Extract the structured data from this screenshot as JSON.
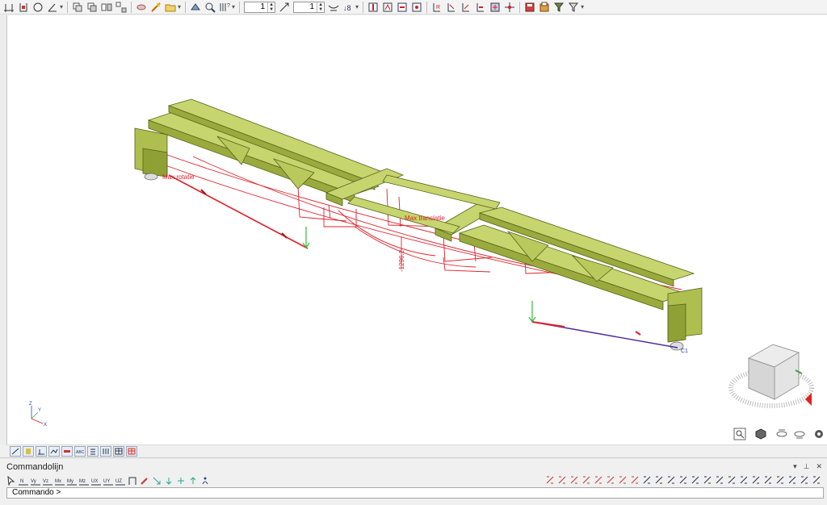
{
  "toolbar": {
    "spin1_value": "1",
    "spin2_value": "1",
    "groups": [
      [
        "axis-icon",
        "node-icon",
        "circle-icon",
        "angle-icon"
      ],
      [
        "copy-layers-icon",
        "copy-icon",
        "mirror-icon",
        "array-icon"
      ],
      [
        "hide-icon",
        "measure-icon",
        "folder-icon"
      ],
      [
        "render-icon",
        "zoom-window-icon",
        "grid-icon"
      ],
      [
        "load-icon",
        "result-icon",
        "member-icon",
        "node-force-icon",
        "section-icon",
        "stress-icon",
        "deflection-icon",
        "check-icon",
        "select-all-icon",
        "pan-icon"
      ],
      [
        "save-icon",
        "report-icon",
        "filter-icon",
        "settings-icon"
      ]
    ]
  },
  "viewport": {
    "labels": {
      "max_rotation": "Max rotatie",
      "max_translation": "Max translatie",
      "dimension": "-1296.2",
      "support_tag": "C1"
    },
    "axes": {
      "z": "Z",
      "y": "Y",
      "x": "X"
    },
    "nav_icons": [
      "zoom-icon",
      "view-cube-icon",
      "orbit-icon",
      "rotate-icon",
      "settings-icon"
    ]
  },
  "viewtabs": [
    "wireframe-tab",
    "solid-tab",
    "loads-tab",
    "results-tab",
    "stress-tab",
    "abc-tab",
    "text-tab",
    "member-tab",
    "table-tab",
    "grid-tab"
  ],
  "command": {
    "title": "Commandolijn",
    "prompt": "Commando >",
    "left_tools": [
      "select-icon",
      "N",
      "Vy",
      "Vz",
      "Mx",
      "My",
      "Mz",
      "UX",
      "UY",
      "UZ",
      "frame-icon",
      "pen-icon",
      "arrow-icon",
      "tri-icon",
      "move-icon",
      "up-icon",
      "accessibility-icon"
    ],
    "right_tools": 23
  },
  "colors": {
    "beam": "#c6d56e",
    "beam_dark": "#9aaa3c",
    "beam_edge": "#55631c",
    "deflection": "#e0202a",
    "purple": "#4a2a9a",
    "green": "#38b838"
  }
}
